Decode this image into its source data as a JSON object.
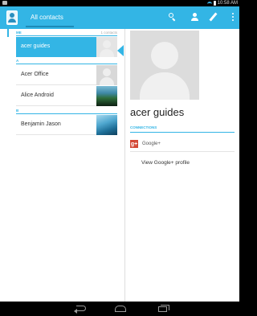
{
  "action_bar": {
    "tab_title": "All contacts",
    "accent_color": "#33b5e5"
  },
  "list": {
    "sections": [
      {
        "letter": "ME",
        "count": "1 contacts"
      },
      {
        "letter": "A"
      },
      {
        "letter": "B"
      }
    ],
    "contacts": [
      {
        "name": "acer guides",
        "selected": true
      },
      {
        "name": "Acer Office"
      },
      {
        "name": "Alice Android"
      },
      {
        "name": "Benjamin Jason"
      }
    ]
  },
  "detail": {
    "name": "acer guides",
    "connections_header": "CONNECTIONS",
    "gplus_label": "Google+",
    "gplus_glyph": "g+",
    "view_profile": "View Google+ profile"
  },
  "status_bar": {
    "time": "10:58 AM"
  }
}
